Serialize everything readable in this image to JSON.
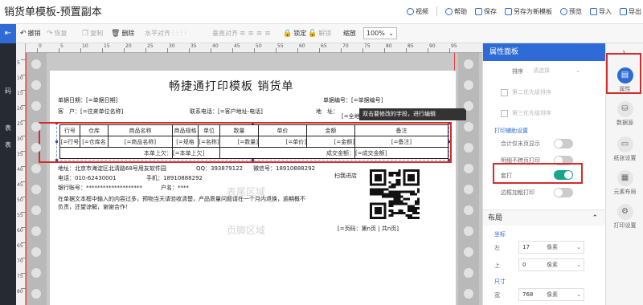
{
  "window": {
    "title": "销货单模板-预置副本"
  },
  "header_actions": [
    {
      "id": "video",
      "label": "视频"
    },
    {
      "id": "help",
      "label": "帮助"
    },
    {
      "id": "save",
      "label": "保存"
    },
    {
      "id": "saveas",
      "label": "另存为新模板"
    },
    {
      "id": "preview",
      "label": "预览"
    },
    {
      "id": "import",
      "label": "导入"
    },
    {
      "id": "export",
      "label": "导出"
    }
  ],
  "toolbar": {
    "undo": "撤销",
    "redo": "恢复",
    "copy": "复制",
    "delete": "删除",
    "halign": "水平对齐",
    "valign": "垂直对齐",
    "lock": "锁定",
    "unlock": "解锁",
    "zoom_label": "缩放",
    "zoom_value": "100%"
  },
  "left_nav": [
    "码",
    "表",
    "表"
  ],
  "ruler": {
    "h": [
      "0",
      "5",
      "10",
      "15",
      "20",
      "25",
      "30",
      "35",
      "40",
      "45",
      "50",
      "55",
      "60",
      "65",
      "70",
      "75",
      "80",
      "85",
      "90",
      "95"
    ],
    "v": [
      "5",
      "10",
      "15",
      "20",
      "25",
      "30",
      "35",
      "40",
      "45",
      "50",
      "55",
      "60",
      "65",
      "70",
      "75",
      "80"
    ]
  },
  "paper": {
    "title": "畅捷通打印模板 销货单",
    "f_date": "单据日期：[=单据日期]",
    "f_no": "单据编号：[=单据编号]",
    "f_cust": "客　户：[=往来单位名称]",
    "f_tel": "联系电话：[=客户地址-电话]",
    "f_addr": "地　址：",
    "f_addr2": "[=全地",
    "table_header": [
      "行号",
      "仓库",
      "商品名称",
      "商品规格",
      "单位",
      "数量",
      "单价",
      "金额",
      "备注"
    ],
    "table_row": [
      "[=行号",
      "[=仓库名",
      "[=商品名称]",
      "[=规格",
      "[=名称]",
      "[=数量]",
      "[=单价]",
      "[=金额]",
      "[=备注]"
    ],
    "total_label": "本单上欠：",
    "total_value": "[=本单上欠]",
    "deal_label": "成交金额：",
    "deal_value": "[=成交金额]",
    "company_addr": "地址：北京市海淀区北清路68号用友软件园",
    "qq": "QQ：393879122",
    "wechat": "微信号：18910888292",
    "tel": "电话：010-62430001",
    "mobile": "手机：18910888292",
    "bank": "银行账号：********************",
    "acct": "户名：****",
    "note1": "在单据文本框中输入的内容过多，预物当天请验收清楚，产品质量问题请在一个月内退换，逾期概不",
    "note2": "负责，还望谅解，谢谢合作！",
    "scan": "扫我进店",
    "footer_area": "表尾区域",
    "page_footer_area": "页脚区域",
    "page_no": "[=页码：第n页 | 共n页]"
  },
  "tooltip": "双击要修改的字段，进行编辑",
  "panel": {
    "title": "属性面板",
    "sort_label": "排序",
    "sort_placeholder": "请选择",
    "prio2": "第二优先级排序",
    "prio3": "第三优先级排序",
    "print_assist": "打印辅助设置",
    "total_only_last": "合计仅末页显示",
    "detail_no_cross": "明细不跨页打印",
    "nested": "套打",
    "border_bold": "边框加粗打印",
    "layout": "布局",
    "coord": "坐标",
    "left": "左",
    "left_value": "17",
    "top": "上",
    "top_value": "0",
    "unit": "像素",
    "size": "尺寸",
    "width": "宽",
    "width_value": "768"
  },
  "side_tabs": [
    "属性",
    "数据源",
    "纸张设置",
    "元素布局",
    "打印设置"
  ]
}
